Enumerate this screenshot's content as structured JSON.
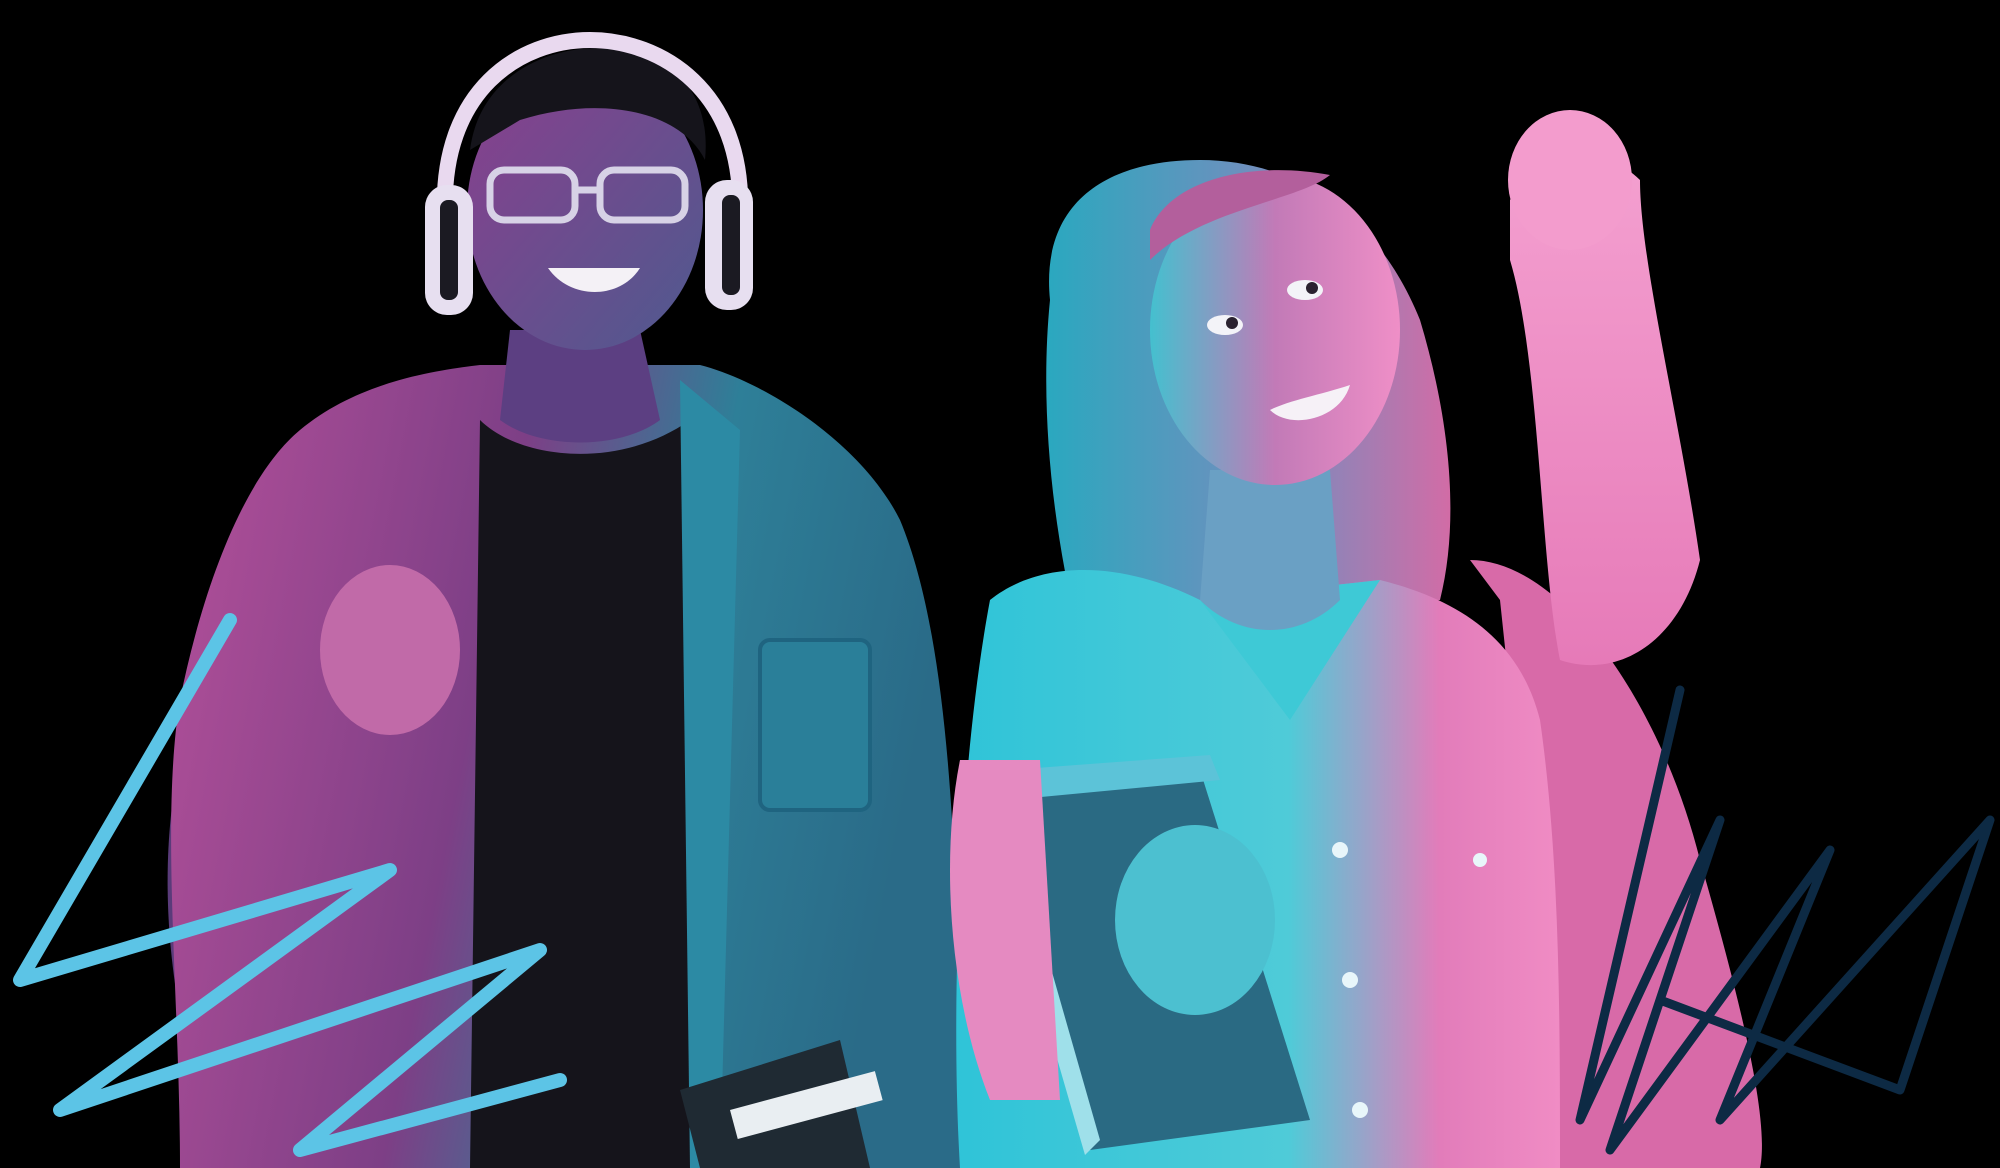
{
  "image": {
    "subject": "duotone-students",
    "colors": {
      "background": "#000000",
      "cyan": "#3cc6d6",
      "teal": "#2a8fa3",
      "magenta": "#d96aa8",
      "pink": "#f08cc4",
      "navy_scribble": "#0d2a44",
      "light_blue_scribble": "#5cc4e6",
      "dark": "#16151c"
    },
    "elements": [
      {
        "name": "student-left",
        "description_icon": "person-with-headphones"
      },
      {
        "name": "student-right",
        "description_icon": "person-cheering-with-books"
      },
      {
        "name": "scribble-left",
        "description_icon": "scribble"
      },
      {
        "name": "scribble-right",
        "description_icon": "scribble"
      }
    ]
  }
}
